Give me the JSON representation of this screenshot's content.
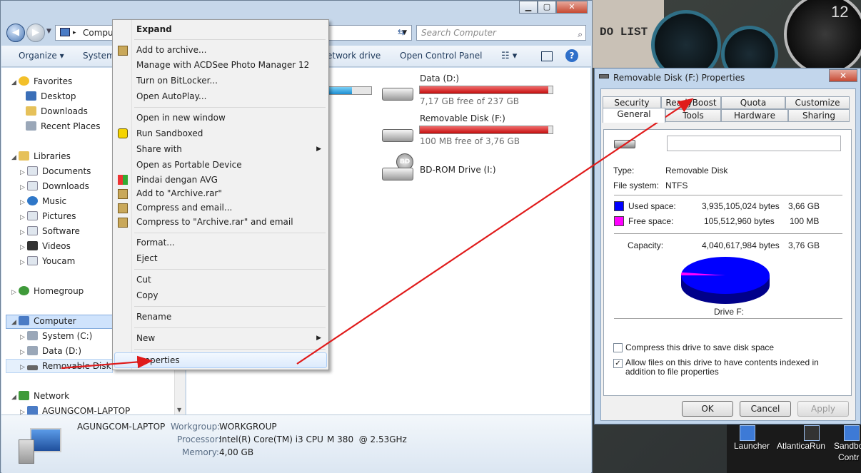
{
  "desktop": {
    "todo_label": "DO LIST",
    "clock_numeral": "12",
    "icons": [
      "Launcher",
      "AtlanticaRun",
      "Sandbo",
      "Contr"
    ]
  },
  "explorer": {
    "address_text": "Compu",
    "search_placeholder": "Search Computer",
    "toolbar": {
      "organize": "Organize ▾",
      "system": "System",
      "map_network": "etwork drive",
      "control_panel": "Open Control Panel"
    },
    "nav": {
      "favorites": "Favorites",
      "desktop": "Desktop",
      "downloads": "Downloads",
      "recent": "Recent Places",
      "libraries": "Libraries",
      "documents": "Documents",
      "lib_downloads": "Downloads",
      "music": "Music",
      "pictures": "Pictures",
      "software": "Software",
      "videos": "Videos",
      "youcam": "Youcam",
      "homegroup": "Homegroup",
      "computer": "Computer",
      "system_c": "System (C:)",
      "data_d": "Data (D:)",
      "removable_f": "Removable Disk (F:)",
      "network": "Network",
      "laptop": "AGUNGCOM-LAPTOP"
    },
    "drives": {
      "d_name": "Data (D:)",
      "d_free": "7,17 GB free of 237 GB",
      "d_used_fraction": 0.97,
      "f_name": "Removable Disk (F:)",
      "f_free": "100 MB free of 3,76 GB",
      "f_used_fraction": 0.97,
      "bd_name": "BD-ROM Drive (I:)",
      "bd_badge": "BD",
      "c_used_fraction": 0.75
    },
    "status": {
      "computer_name": "AGUNGCOM-LAPTOP",
      "workgroup_label": "Workgroup:",
      "workgroup_value": "WORKGROUP",
      "processor_label": "Processor:",
      "processor_value": "Intel(R) Core(TM) i3 CPU",
      "processor_model": "M 380  @ 2.53GHz",
      "memory_label": "Memory:",
      "memory_value": "4,00 GB"
    }
  },
  "context_menu": {
    "expand": "Expand",
    "add_archive": "Add to archive...",
    "acdsee": "Manage with ACDSee Photo Manager 12",
    "bitlocker": "Turn on BitLocker...",
    "autoplay": "Open AutoPlay...",
    "new_window": "Open in new window",
    "sandboxed": "Run Sandboxed",
    "share_with": "Share with",
    "portable": "Open as Portable Device",
    "avg": "Pindai dengan AVG",
    "add_rar": "Add to \"Archive.rar\"",
    "compress_email": "Compress and email...",
    "compress_rar_email": "Compress to \"Archive.rar\" and email",
    "format": "Format...",
    "eject": "Eject",
    "cut": "Cut",
    "copy": "Copy",
    "rename": "Rename",
    "new": "New",
    "properties": "Properties"
  },
  "properties_dialog": {
    "title": "Removable Disk (F:) Properties",
    "close": "✕",
    "tabs_top": [
      "Security",
      "ReadyBoost",
      "Quota",
      "Customize"
    ],
    "tabs_bottom": [
      "General",
      "Tools",
      "Hardware",
      "Sharing"
    ],
    "type_label": "Type:",
    "type_value": "Removable Disk",
    "fs_label": "File system:",
    "fs_value": "NTFS",
    "used_label": "Used space:",
    "used_bytes": "3,935,105,024 bytes",
    "used_gb": "3,66 GB",
    "free_label": "Free space:",
    "free_bytes": "105,512,960 bytes",
    "free_mb": "100 MB",
    "capacity_label": "Capacity:",
    "capacity_bytes": "4,040,617,984 bytes",
    "capacity_gb": "3,76 GB",
    "drive_label": "Drive F:",
    "used_color": "#0000ff",
    "free_color": "#ff00ff",
    "used_fraction": 0.974,
    "compress_label": "Compress this drive to save disk space",
    "index_label": "Allow files on this drive to have contents indexed in addition to file properties",
    "ok": "OK",
    "cancel": "Cancel",
    "apply": "Apply"
  }
}
